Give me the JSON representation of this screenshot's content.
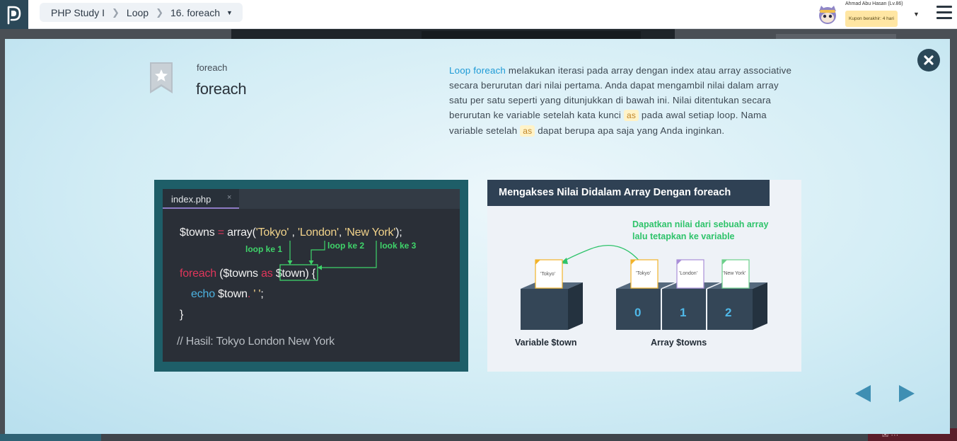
{
  "header": {
    "breadcrumb": [
      "PHP Study I",
      "Loop",
      "16. foreach"
    ],
    "user_name": "Ahmad Abu Hasan (Lv.86)",
    "coupon": "Kupon berakhir: 4 hari"
  },
  "lesson": {
    "subtitle": "foreach",
    "title": "foreach",
    "description": {
      "highlight": "Loop foreach",
      "part1": " melakukan iterasi pada array dengan index atau array associative secara berurutan dari nilai pertama. Anda dapat mengambil nilai dalam array satu per satu seperti yang ditunjukkan di bawah ini. Nilai ditentukan secara berurutan ke variable setelah kata kunci ",
      "code1": "as",
      "part2": " pada awal setiap loop. Nama variable setelah ",
      "code2": "as",
      "part3": " dapat berupa apa saja yang Anda inginkan."
    }
  },
  "code_image": {
    "tab": "index.php",
    "tab_close": "×",
    "line1": {
      "a": "$towns ",
      "b": "=",
      "c": " array(",
      "d": "'Tokyo'",
      "e": " , ",
      "f": "'London'",
      "g": ", ",
      "h": "'New York'",
      "i": ");"
    },
    "line2": {
      "a": "foreach",
      "b": " ($towns ",
      "c": "as",
      "d": " $town",
      "e": ") {"
    },
    "line3": {
      "a": "echo",
      "b": " $town",
      "c": ". ",
      "d": "' '",
      "e": ";"
    },
    "line4": "}",
    "comment": "// Hasil: Tokyo London New York",
    "labels": [
      "loop ke 1",
      "loop ke 2",
      "look ke 3"
    ]
  },
  "diagram_image": {
    "title": "Mengakses Nilai Didalam Array Dengan foreach",
    "note": [
      "Dapatkan nilai dari sebuah array",
      "lalu tetapkan ke variable"
    ],
    "cards": [
      "'Tokyo'",
      "'Tokyo'",
      "'London'",
      "'New York'"
    ],
    "indices": [
      "0",
      "1",
      "2"
    ],
    "variable_label": "Variable $town",
    "array_label": "Array $towns"
  },
  "colors": {
    "header_dark": "#2b4858",
    "modal_bg": "#d3edf5",
    "highlight": "#1d9ad6",
    "arrow": "#3f8fb3",
    "keyword": "#e0365b",
    "string": "#f1d28a",
    "green": "#3fd46a"
  }
}
